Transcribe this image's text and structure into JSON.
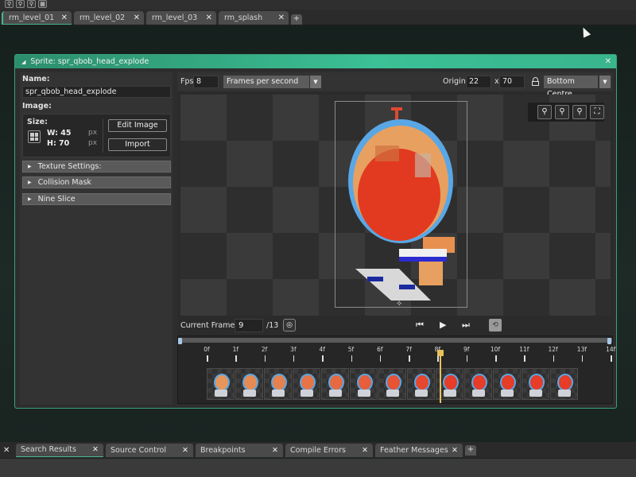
{
  "toolbar": {
    "icons": [
      "zoom-out-icon",
      "zoom-in-icon",
      "zoom-reset-icon",
      "basket-icon"
    ]
  },
  "room_tabs": [
    {
      "label": "rm_level_01",
      "active": true
    },
    {
      "label": "rm_level_02",
      "active": false
    },
    {
      "label": "rm_level_03",
      "active": false
    },
    {
      "label": "rm_splash",
      "active": false
    }
  ],
  "tab_close_glyph": "✕",
  "tab_add_glyph": "+",
  "sprite_window": {
    "title": "Sprite: spr_qbob_head_explode",
    "close_glyph": "✕",
    "accent_color": "#3cc095"
  },
  "left_panel": {
    "name_label": "Name:",
    "name_value": "spr_qbob_head_explode",
    "image_label": "Image:",
    "size_label": "Size:",
    "width_text": "W: 45",
    "height_text": "H: 70",
    "unit": "px",
    "edit_image_button": "Edit Image",
    "import_button": "Import",
    "sections": [
      {
        "label": "Texture Settings:"
      },
      {
        "label": "Collision Mask"
      },
      {
        "label": "Nine Slice"
      }
    ]
  },
  "editor": {
    "fps_label": "Fps",
    "fps_value": "8",
    "speed_mode": "Frames per second",
    "origin_label": "Origin",
    "origin_x": "22",
    "origin_sep": "x",
    "origin_y": "70",
    "origin_preset": "Bottom Centre",
    "zoom_buttons": [
      "zoom-out-icon",
      "zoom-in-icon",
      "zoom-reset-icon",
      "fit-screen-icon"
    ]
  },
  "playback": {
    "current_frame_label": "Current Frame:",
    "current_frame_value": "9",
    "total_frames_text": "/13"
  },
  "timeline": {
    "tick_labels": [
      "0f",
      "1f",
      "2f",
      "3f",
      "4f",
      "5f",
      "6f",
      "7f",
      "8f",
      "9f",
      "10f",
      "11f",
      "12f",
      "13f",
      "14f"
    ],
    "frame_count": 13,
    "current_frame_index": 8,
    "playhead_color": "#e8c15a"
  },
  "bottom_tabs": [
    {
      "label": "Search Results",
      "active": true
    },
    {
      "label": "Source Control",
      "active": false
    },
    {
      "label": "Breakpoints",
      "active": false
    },
    {
      "label": "Compile Errors",
      "active": false
    },
    {
      "label": "Feather Messages",
      "active": false
    }
  ]
}
